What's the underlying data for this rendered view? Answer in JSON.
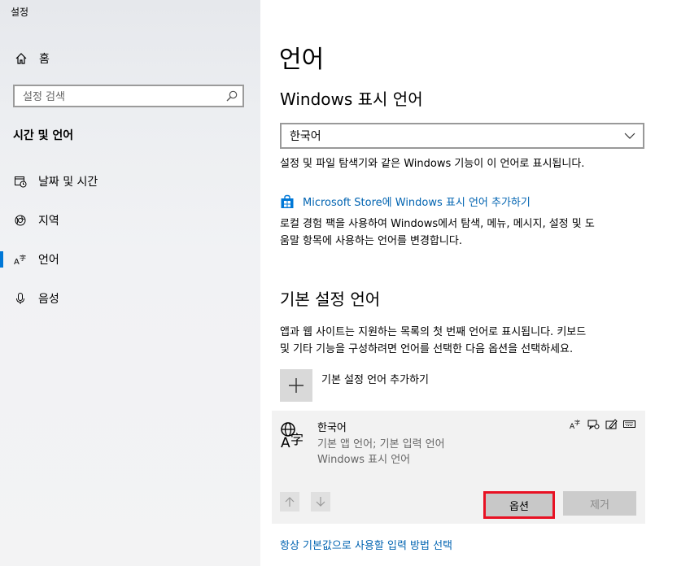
{
  "window": {
    "title": "설정"
  },
  "sidebar": {
    "home_label": "홈",
    "search_placeholder": "설정 검색",
    "section_title": "시간 및 언어",
    "items": [
      {
        "label": "날짜 및 시간",
        "icon": "calendar-clock-icon"
      },
      {
        "label": "지역",
        "icon": "globe-icon"
      },
      {
        "label": "언어",
        "icon": "language-icon",
        "active": true
      },
      {
        "label": "음성",
        "icon": "microphone-icon"
      }
    ]
  },
  "main": {
    "title": "언어",
    "display_language": {
      "heading": "Windows 표시 언어",
      "selected": "한국어",
      "description": "설정 및 파일 탐색기와 같은 Windows 기능이 이 언어로 표시됩니다.",
      "store_link": "Microsoft Store에 Windows 표시 언어 추가하기",
      "store_desc_line1": "로컬 경험 팩을 사용하여 Windows에서 탐색, 메뉴, 메시지, 설정 및 도",
      "store_desc_line2": "움말 항목에 사용하는 언어를 변경합니다."
    },
    "preferred": {
      "heading": "기본 설정 언어",
      "desc_line1": "앱과 웹 사이트는 지원하는 목록의 첫 번째 언어로 표시됩니다. 키보드",
      "desc_line2": "및 기타 기능을 구성하려면 언어를 선택한 다음 옵션을 선택하세요.",
      "add_label": "기본 설정 언어 추가하기",
      "language": {
        "name": "한국어",
        "sub1": "기본 앱 언어; 기본 입력 언어",
        "sub2": "Windows 표시 언어",
        "options_label": "옵션",
        "remove_label": "제거"
      }
    },
    "bottom_link": "항상 기본값으로 사용할 입력 방법 선택"
  },
  "colors": {
    "accent": "#0078d7",
    "link": "#0063b1",
    "highlight": "#e81123"
  }
}
